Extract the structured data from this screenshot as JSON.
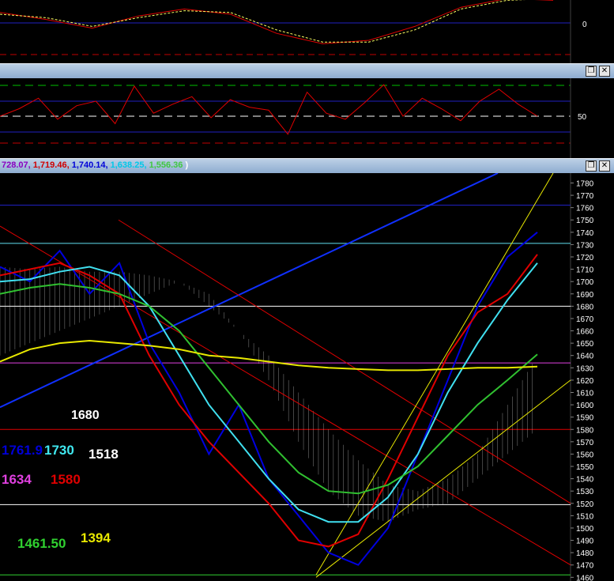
{
  "panels": {
    "top": {
      "axis_tick_label": "0"
    },
    "middle": {
      "axis_tick_label": "50"
    },
    "main": {
      "legend_values": [
        {
          "text": "728.07,",
          "color": "#8a00c0"
        },
        {
          "text": " 1,719.46,",
          "color": "#d00000"
        },
        {
          "text": " 1,740.14,",
          "color": "#0000d8"
        },
        {
          "text": " 1,638.25,",
          "color": "#00c8e8"
        },
        {
          "text": " 1,556.36",
          "color": "#40c840"
        },
        {
          "text": " )",
          "color": "#ffffff"
        }
      ],
      "price_ticks": [
        "1780",
        "1770",
        "1760",
        "1750",
        "1740",
        "1730",
        "1720",
        "1710",
        "1700",
        "1690",
        "1680",
        "1670",
        "1660",
        "1650",
        "1640",
        "1630",
        "1620",
        "1610",
        "1600",
        "1590",
        "1580",
        "1570",
        "1560",
        "1550",
        "1540",
        "1530",
        "1520",
        "1510",
        "1500",
        "1490",
        "1480",
        "1470",
        "1460"
      ],
      "annotations": [
        {
          "text": "1680",
          "color": "#ffffff"
        },
        {
          "text": "1761.9",
          "color": "#0000d8"
        },
        {
          "text": "1730",
          "color": "#40e8f0"
        },
        {
          "text": "1518",
          "color": "#ffffff"
        },
        {
          "text": "1634",
          "color": "#e040e0"
        },
        {
          "text": "1580",
          "color": "#e00000"
        },
        {
          "text": "1461.50",
          "color": "#30d030"
        },
        {
          "text": "1394",
          "color": "#e8e800"
        }
      ]
    }
  },
  "window_buttons": {
    "restore": "❐",
    "close": "✕"
  },
  "colors": {
    "background": "#000000",
    "grid_blue": "#2020c0",
    "price": "#e8e8e8",
    "ma_red": "#e00000",
    "ma_magenta": "#e040e0",
    "ma_cyan": "#40e0f0",
    "ma_green": "#30c030",
    "ma_yellow": "#e8e800",
    "lagging_blue": "#0000e0"
  },
  "chart_data": [
    {
      "type": "line",
      "title": "",
      "series": [
        {
          "values": [
            0.6,
            0.2,
            -0.3,
            0.4,
            0.8,
            0.5,
            -0.6,
            -1.2,
            -1.0,
            -0.2,
            0.9,
            1.4,
            1.3
          ]
        },
        {
          "values": [
            0.5,
            0.3,
            -0.2,
            0.3,
            0.7,
            0.6,
            -0.4,
            -1.1,
            -1.1,
            -0.4,
            0.8,
            1.3,
            1.4
          ]
        }
      ]
    },
    {
      "type": "line",
      "title": "",
      "series": [
        {
          "values": [
            50,
            55,
            62,
            48,
            57,
            60,
            45,
            70,
            52,
            58,
            63,
            49,
            61,
            56,
            54,
            38,
            66,
            52,
            48,
            59,
            71,
            50,
            62,
            55,
            47,
            60,
            68,
            58,
            50
          ]
        }
      ]
    },
    {
      "type": "line",
      "title": "",
      "ylim": [
        1457,
        1788
      ],
      "series": [
        {
          "name": "1,740.14",
          "values": [
            1712,
            1700,
            1725,
            1690,
            1715,
            1650,
            1610,
            1560,
            1600,
            1540,
            1510,
            1480,
            1470,
            1500,
            1560,
            1620,
            1680,
            1720,
            1740
          ]
        },
        {
          "name": "1,719.46",
          "values": [
            1705,
            1710,
            1715,
            1705,
            1690,
            1640,
            1600,
            1570,
            1545,
            1520,
            1490,
            1485,
            1495,
            1540,
            1590,
            1640,
            1675,
            1690,
            1722
          ]
        },
        {
          "name": "1,638.25",
          "values": [
            1700,
            1702,
            1708,
            1712,
            1705,
            1680,
            1640,
            1600,
            1570,
            1540,
            1515,
            1505,
            1505,
            1525,
            1560,
            1610,
            1650,
            1685,
            1715
          ]
        },
        {
          "name": "1,556.36",
          "values": [
            1690,
            1695,
            1698,
            1695,
            1690,
            1680,
            1660,
            1630,
            1600,
            1570,
            1545,
            1530,
            1528,
            1535,
            1550,
            1575,
            1600,
            1620,
            1641
          ]
        },
        {
          "name": "728.07",
          "values": [
            1635,
            1645,
            1650,
            1652,
            1650,
            1648,
            1645,
            1640,
            1638,
            1635,
            1632,
            1630,
            1629,
            1628,
            1628,
            1629,
            1630,
            1630,
            1631
          ]
        }
      ]
    }
  ]
}
